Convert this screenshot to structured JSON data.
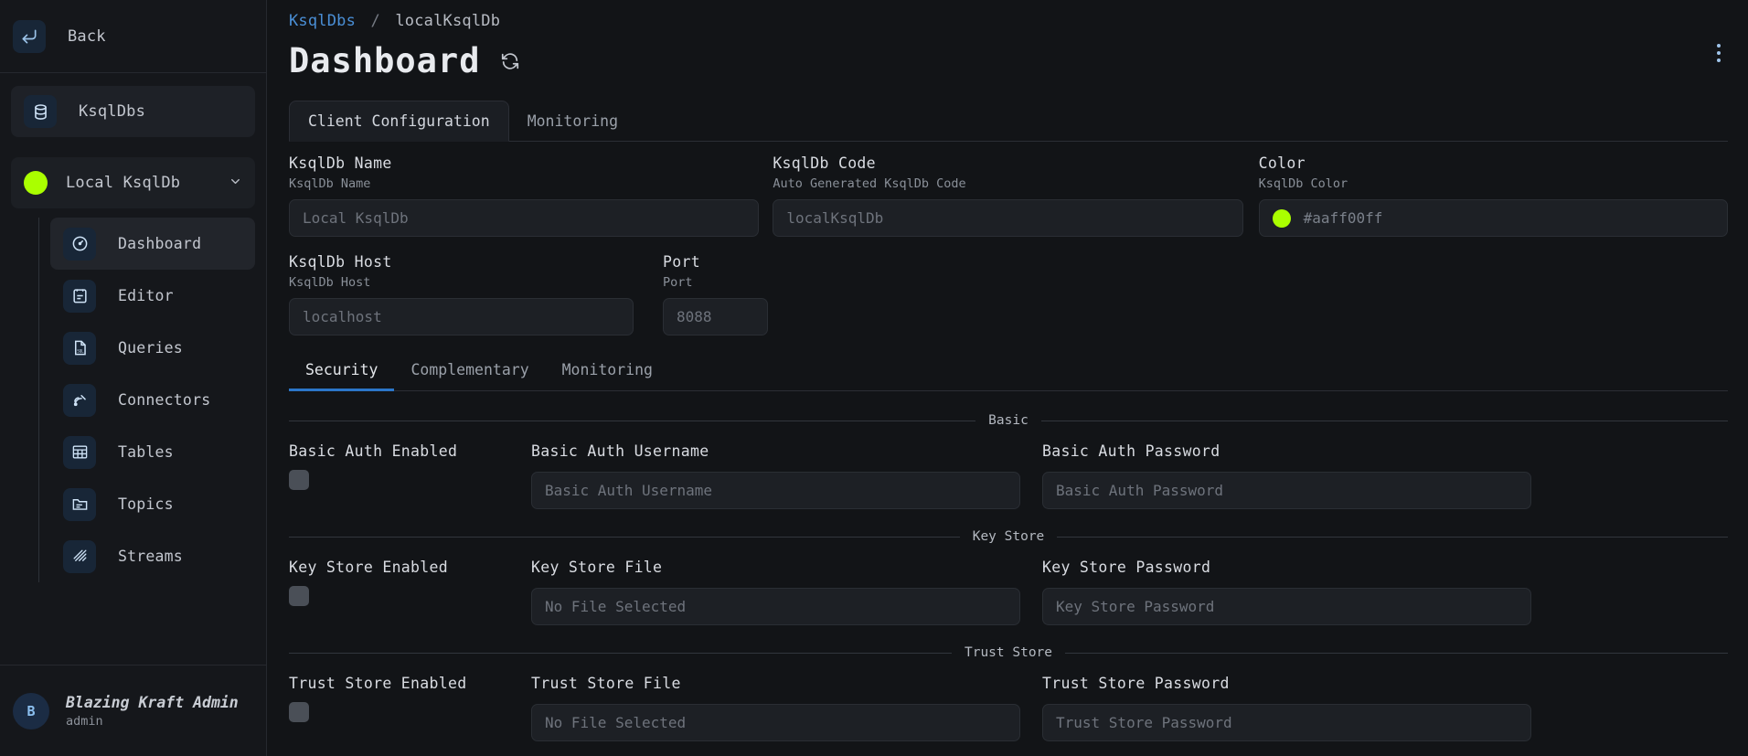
{
  "sidebar": {
    "back_label": "Back",
    "back_icon": "arrow-left-enter-icon",
    "ksqldbs_label": "KsqlDbs",
    "ksqldbs_icon": "database-icon",
    "selected_db": {
      "label": "Local KsqlDb",
      "dot_color": "#aaff00",
      "chevron": "⌄"
    },
    "nav_items": [
      {
        "label": "Dashboard",
        "icon": "gauge-icon",
        "active": true
      },
      {
        "label": "Editor",
        "icon": "clipboard-icon",
        "active": false
      },
      {
        "label": "Queries",
        "icon": "sql-file-icon",
        "active": false
      },
      {
        "label": "Connectors",
        "icon": "plug-icon",
        "active": false
      },
      {
        "label": "Tables",
        "icon": "table-icon",
        "active": false
      },
      {
        "label": "Topics",
        "icon": "folder-icon",
        "active": false
      },
      {
        "label": "Streams",
        "icon": "streams-icon",
        "active": false
      }
    ],
    "user": {
      "initial": "B",
      "name": "Blazing Kraft Admin",
      "role": "admin"
    }
  },
  "header": {
    "breadcrumb_root": "KsqlDbs",
    "breadcrumb_sep": "/",
    "breadcrumb_current": "localKsqlDb",
    "title": "Dashboard",
    "refresh_icon": "refresh-icon",
    "menu_icon": "kebab-menu-icon"
  },
  "tabs": [
    {
      "label": "Client Configuration",
      "active": true
    },
    {
      "label": "Monitoring",
      "active": false
    }
  ],
  "config_fields": {
    "name": {
      "label": "KsqlDb Name",
      "sublabel": "KsqlDb Name",
      "placeholder": "Local KsqlDb"
    },
    "code": {
      "label": "KsqlDb Code",
      "sublabel": "Auto Generated KsqlDb Code",
      "placeholder": "localKsqlDb"
    },
    "color": {
      "label": "Color",
      "sublabel": "KsqlDb Color",
      "value": "#aaff00ff",
      "swatch": "#aaff00"
    },
    "host": {
      "label": "KsqlDb Host",
      "sublabel": "KsqlDb Host",
      "placeholder": "localhost"
    },
    "port": {
      "label": "Port",
      "sublabel": "Port",
      "placeholder": "8088"
    }
  },
  "subtabs": [
    {
      "label": "Security",
      "active": true
    },
    {
      "label": "Complementary",
      "active": false
    },
    {
      "label": "Monitoring",
      "active": false
    }
  ],
  "security": {
    "sections": [
      {
        "title": "Basic",
        "checkbox_label": "Basic Auth Enabled",
        "checked": false,
        "field_a": {
          "label": "Basic Auth Username",
          "placeholder": "Basic Auth Username"
        },
        "field_b": {
          "label": "Basic Auth Password",
          "placeholder": "Basic Auth Password"
        }
      },
      {
        "title": "Key Store",
        "checkbox_label": "Key Store Enabled",
        "checked": false,
        "field_a": {
          "label": "Key Store File",
          "placeholder": "No File Selected"
        },
        "field_b": {
          "label": "Key Store Password",
          "placeholder": "Key Store Password"
        }
      },
      {
        "title": "Trust Store",
        "checkbox_label": "Trust Store Enabled",
        "checked": false,
        "field_a": {
          "label": "Trust Store File",
          "placeholder": "No File Selected"
        },
        "field_b": {
          "label": "Trust Store Password",
          "placeholder": "Trust Store Password"
        }
      }
    ]
  },
  "colors": {
    "accent_blue": "#2b76c9",
    "link_blue": "#4a8fd6",
    "brand_green": "#aaff00",
    "bg": "#121417",
    "panel": "#15171b"
  }
}
